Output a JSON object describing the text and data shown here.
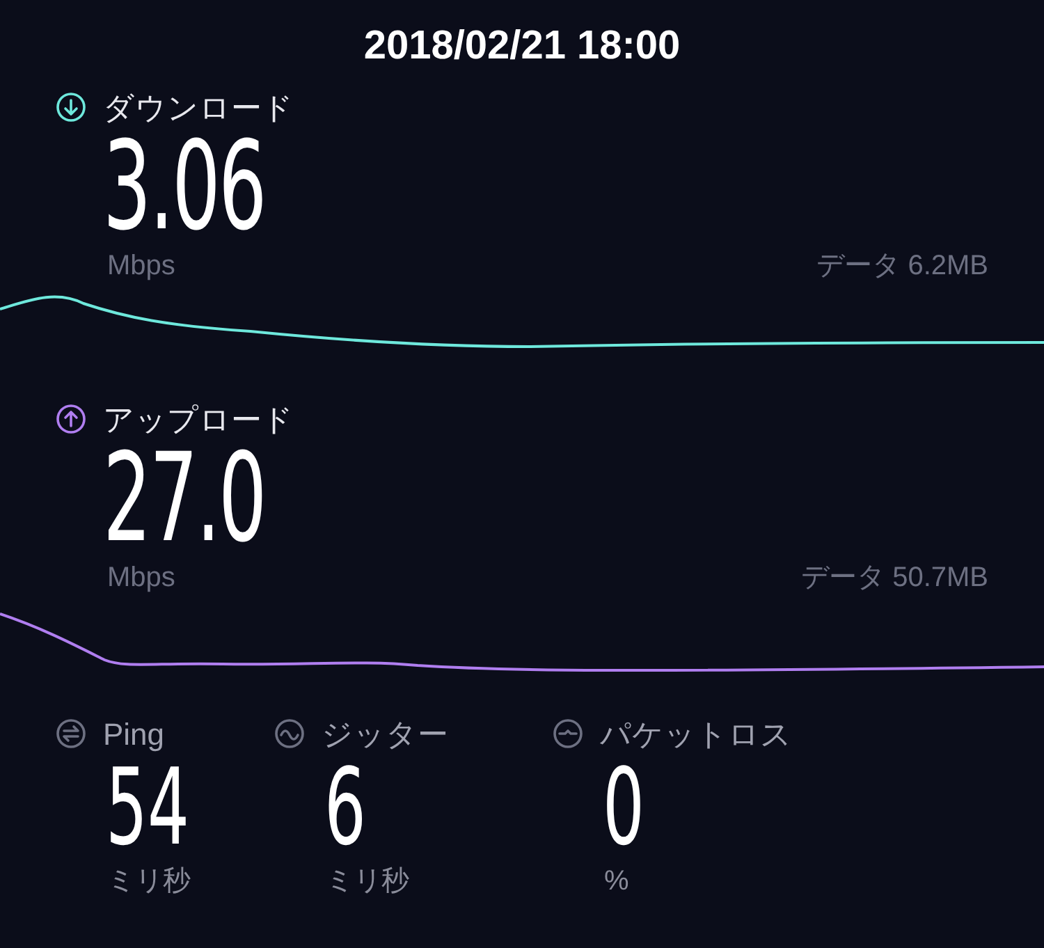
{
  "title": "2018/02/21 18:00",
  "sections": [
    {
      "kind": "download",
      "label": "ダウンロード",
      "value": "3.06",
      "unit": "Mbps",
      "data": "データ 6.2MB",
      "color": "#6ee8dc"
    },
    {
      "kind": "upload",
      "label": "アップロード",
      "value": "27.0",
      "unit": "Mbps",
      "data": "データ 50.7MB",
      "color": "#b07ef0"
    }
  ],
  "stats": [
    {
      "kind": "ping",
      "label": "Ping",
      "value": "54",
      "unit": "ミリ秒"
    },
    {
      "kind": "jitter",
      "label": "ジッター",
      "value": "6",
      "unit": "ミリ秒"
    },
    {
      "kind": "loss",
      "label": "パケットロス",
      "value": "0",
      "unit": "%"
    }
  ]
}
